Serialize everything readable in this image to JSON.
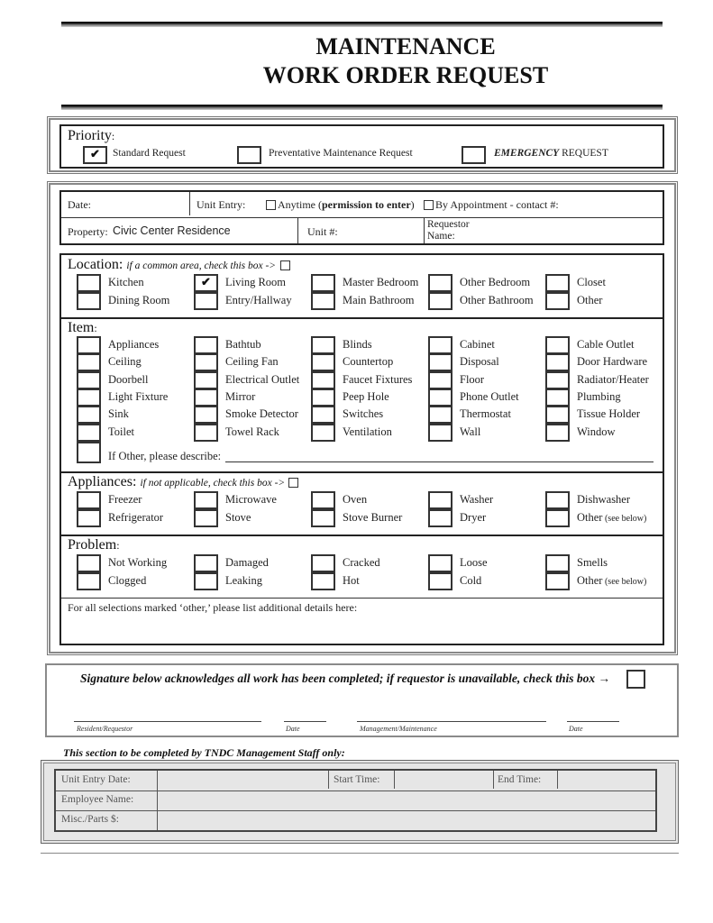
{
  "title": {
    "line1": "MAINTENANCE",
    "line2": "WORK ORDER REQUEST"
  },
  "priority": {
    "label": "Priority",
    "options": [
      {
        "label": "Standard Request",
        "checked": true,
        "mark": "✔"
      },
      {
        "label": "Preventative Maintenance Request",
        "checked": false,
        "mark": ""
      },
      {
        "label_emphasis": "EMERGENCY",
        "label_rest": "REQUEST",
        "checked": false,
        "mark": ""
      }
    ]
  },
  "info": {
    "date_label": "Date:",
    "unit_entry_label": "Unit Entry:",
    "anytime_label": "Anytime (",
    "anytime_bold": "permission to enter",
    "anytime_close": ")",
    "appointment_label": "By Appointment - contact #:",
    "property_label": "Property:",
    "property_value": "Civic Center Residence",
    "unit_label": "Unit #:",
    "requestor_label_1": "Requestor",
    "requestor_label_2": "Name:"
  },
  "location": {
    "label": "Location",
    "hint": "if a common area, check this box ->",
    "items": [
      {
        "label": "Kitchen",
        "checked": false,
        "mark": ""
      },
      {
        "label": "Living Room",
        "checked": true,
        "mark": "✔"
      },
      {
        "label": "Master Bedroom",
        "checked": false,
        "mark": ""
      },
      {
        "label": "Other Bedroom",
        "checked": false,
        "mark": ""
      },
      {
        "label": "Closet",
        "checked": false,
        "mark": ""
      },
      {
        "label": "Dining Room",
        "checked": false,
        "mark": ""
      },
      {
        "label": "Entry/Hallway",
        "checked": false,
        "mark": ""
      },
      {
        "label": "Main Bathroom",
        "checked": false,
        "mark": ""
      },
      {
        "label": "Other Bathroom",
        "checked": false,
        "mark": ""
      },
      {
        "label": "Other",
        "checked": false,
        "mark": ""
      }
    ]
  },
  "item": {
    "label": "Item",
    "items": [
      "Appliances",
      "Bathtub",
      "Blinds",
      "Cabinet",
      "Cable Outlet",
      "Ceiling",
      "Ceiling Fan",
      "Countertop",
      "Disposal",
      "Door Hardware",
      "Doorbell",
      "Electrical Outlet",
      "Faucet Fixtures",
      "Floor",
      "Radiator/Heater",
      "Light Fixture",
      "Mirror",
      "Peep Hole",
      "Phone Outlet",
      "Plumbing",
      "Sink",
      "Smoke Detector",
      "Switches",
      "Thermostat",
      "Tissue Holder",
      "Toilet",
      "Towel Rack",
      "Ventilation",
      "Wall",
      "Window"
    ],
    "other_label": "If Other, please describe:"
  },
  "appliances": {
    "label": "Appliances",
    "hint": "if not applicable, check this box ->",
    "items": [
      {
        "main": "Freezer",
        "small": ""
      },
      {
        "main": "Microwave",
        "small": ""
      },
      {
        "main": "Oven",
        "small": ""
      },
      {
        "main": "Washer",
        "small": ""
      },
      {
        "main": "Dishwasher",
        "small": ""
      },
      {
        "main": "Refrigerator",
        "small": ""
      },
      {
        "main": "Stove",
        "small": ""
      },
      {
        "main": "Stove Burner",
        "small": ""
      },
      {
        "main": "Dryer",
        "small": ""
      },
      {
        "main": "Other",
        "small": "(see below)"
      }
    ]
  },
  "problem": {
    "label": "Problem",
    "items": [
      {
        "main": "Not Working",
        "small": ""
      },
      {
        "main": "Damaged",
        "small": ""
      },
      {
        "main": "Cracked",
        "small": ""
      },
      {
        "main": "Loose",
        "small": ""
      },
      {
        "main": "Smells",
        "small": ""
      },
      {
        "main": "Clogged",
        "small": ""
      },
      {
        "main": "Leaking",
        "small": ""
      },
      {
        "main": "Hot",
        "small": ""
      },
      {
        "main": "Cold",
        "small": ""
      },
      {
        "main": "Other",
        "small": "(see below)"
      }
    ]
  },
  "details": {
    "label": "For all selections marked ‘other,’ please list additional details here:"
  },
  "signature": {
    "statement": "Signature below acknowledges all work has been completed; if requestor is unavailable, check this box →",
    "captions": [
      "Resident/Requestor",
      "Date",
      "Management/Maintenance",
      "Date"
    ]
  },
  "management": {
    "heading": "This section to be completed by TNDC Management Staff only:",
    "unit_entry_date": "Unit Entry Date:",
    "start_time": "Start Time:",
    "end_time": "End Time:",
    "employee_name": "Employee Name:",
    "misc_parts": "Misc./Parts $:"
  }
}
